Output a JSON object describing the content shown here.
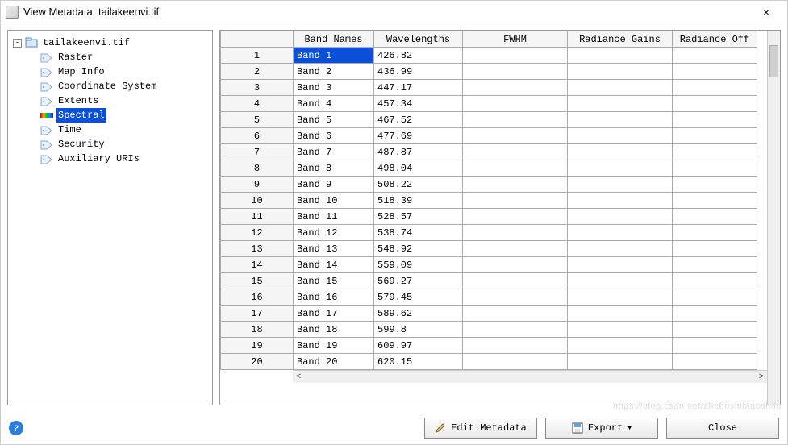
{
  "window": {
    "title": "View Metadata: tailakeenvi.tif",
    "close_glyph": "×"
  },
  "tree": {
    "root_label": "tailakeenvi.tif",
    "toggle_glyph": "-",
    "items": [
      {
        "label": "Raster"
      },
      {
        "label": "Map Info"
      },
      {
        "label": "Coordinate System"
      },
      {
        "label": "Extents"
      },
      {
        "label": "Spectral",
        "selected": true
      },
      {
        "label": "Time"
      },
      {
        "label": "Security"
      },
      {
        "label": "Auxiliary URIs"
      }
    ]
  },
  "table": {
    "columns": [
      "Band Names",
      "Wavelengths",
      "FWHM",
      "Radiance Gains",
      "Radiance Off"
    ],
    "rows": [
      {
        "n": "1",
        "band": "Band 1",
        "wave": "426.82",
        "sel": true
      },
      {
        "n": "2",
        "band": "Band 2",
        "wave": "436.99"
      },
      {
        "n": "3",
        "band": "Band 3",
        "wave": "447.17"
      },
      {
        "n": "4",
        "band": "Band 4",
        "wave": "457.34"
      },
      {
        "n": "5",
        "band": "Band 5",
        "wave": "467.52"
      },
      {
        "n": "6",
        "band": "Band 6",
        "wave": "477.69"
      },
      {
        "n": "7",
        "band": "Band 7",
        "wave": "487.87"
      },
      {
        "n": "8",
        "band": "Band 8",
        "wave": "498.04"
      },
      {
        "n": "9",
        "band": "Band 9",
        "wave": "508.22"
      },
      {
        "n": "10",
        "band": "Band 10",
        "wave": "518.39"
      },
      {
        "n": "11",
        "band": "Band 11",
        "wave": "528.57"
      },
      {
        "n": "12",
        "band": "Band 12",
        "wave": "538.74"
      },
      {
        "n": "13",
        "band": "Band 13",
        "wave": "548.92"
      },
      {
        "n": "14",
        "band": "Band 14",
        "wave": "559.09"
      },
      {
        "n": "15",
        "band": "Band 15",
        "wave": "569.27"
      },
      {
        "n": "16",
        "band": "Band 16",
        "wave": "579.45"
      },
      {
        "n": "17",
        "band": "Band 17",
        "wave": "589.62"
      },
      {
        "n": "18",
        "band": "Band 18",
        "wave": "599.8"
      },
      {
        "n": "19",
        "band": "Band 19",
        "wave": "609.97"
      },
      {
        "n": "20",
        "band": "Band 20",
        "wave": "620.15"
      }
    ],
    "hscroll_left": "<",
    "hscroll_right": ">"
  },
  "footer": {
    "help_glyph": "?",
    "edit_label": "Edit Metadata",
    "export_label": "Export",
    "export_arrow": "▼",
    "close_label": "Close"
  },
  "watermark": "https://blog.csdn.net/zhebushibiaoshifu"
}
